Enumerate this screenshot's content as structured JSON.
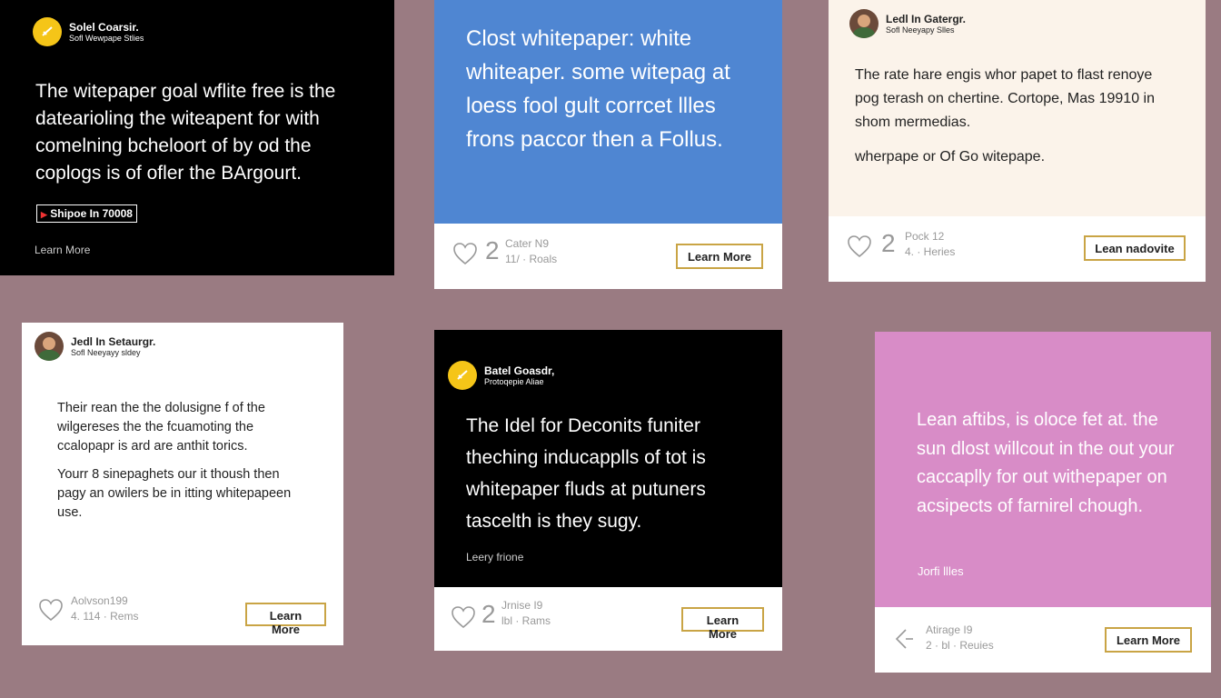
{
  "cards": [
    {
      "brand_name": "Solel Coarsir.",
      "brand_sub": "Sofl Wewpape Stlies",
      "body": "The witepaper goal wflite free is the datearioling the witeapent for with comelning bcheloort of by od the coplogs is of ofler the BArgourt.",
      "tag": "Shipoe In 70008",
      "link": "Learn More"
    },
    {
      "body": "Clost whitepaper: white whiteaper. some witepag at loess fool gult corrcet llles frons paccor then a Follus.",
      "likes": "2",
      "meta1": "Cater N9",
      "meta2": "11/ · Roals",
      "button": "Learn More"
    },
    {
      "brand_name": "Ledl In Gatergr.",
      "brand_sub": "Sofl Neeyapy Slles",
      "para1": "The rate hare engis whor papet to flast renoye pog terash on chertine. Cortope, Mas 19910 in shom mermedias.",
      "para2": "wherpape or Of Go witepape.",
      "likes": "2",
      "meta1": "Pock 12",
      "meta2": "4. · Heries",
      "button": "Lean nadovite"
    },
    {
      "brand_name": "Jedl In Setaurgr.",
      "brand_sub": "Sofl Neeyayy sldey",
      "para1": "Their rean the the dolusigne f of the wilgereses the the fcuamoting the ccalopapr is ard are anthit torics.",
      "para2": "Yourr 8 sinepaghets our it thoush then pagy an owilers be in itting whitepapeen use.",
      "meta1": "Aolvson199",
      "meta2": "4. 114 · Rems",
      "button": "Learn More"
    },
    {
      "brand_name": "Batel Goasdr,",
      "brand_sub": "Protoqepie Aliae",
      "body": "The Idel for Deconits funiter theching inducapplls of tot is whitepaper fluds at putuners tascelth is they sugy.",
      "link": "Leery frione",
      "likes": "2",
      "meta1": "Jrnise I9",
      "meta2": "lbl · Rams",
      "button": "Learn More"
    },
    {
      "body": "Lean aftibs, is oloce fet at. the sun dlost willcout in the out your caccaplly for out withepaper on acsipects of farnirel chough.",
      "link": "Jorfi llles",
      "meta1": "Atirage I9",
      "meta2": "2 · bl · Reuies",
      "button": "Learn More"
    }
  ],
  "colors": {
    "background": "#9a7b82",
    "blue": "#4f86d2",
    "pink": "#d88cc7",
    "cream": "#fbf3ea",
    "black": "#000000",
    "accent_gold": "#c9a445",
    "logo_yellow": "#f5c518"
  },
  "icons": [
    "logo-check-icon",
    "avatar",
    "heart-icon",
    "share-icon",
    "play-icon"
  ]
}
